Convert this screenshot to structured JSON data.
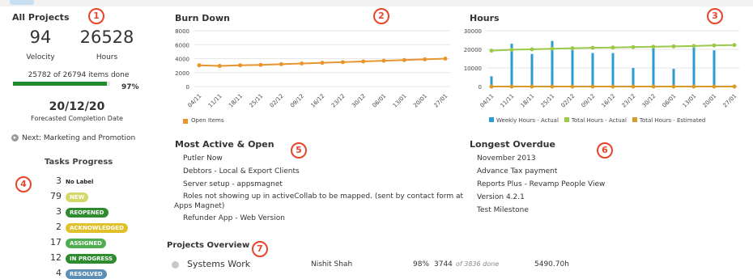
{
  "all_projects": {
    "title": "All Projects",
    "velocity_value": "94",
    "velocity_label": "Velocity",
    "hours_value": "26528",
    "hours_label": "Hours",
    "items_done": "25782 of 26794 items done",
    "progress_pct": "97%",
    "progress_fraction": 0.97,
    "forecast_date": "20/12/20",
    "forecast_label": "Forecasted Completion Date",
    "next_text": "Next: Marketing and Promotion"
  },
  "tasks_progress": {
    "title": "Tasks Progress",
    "rows": [
      {
        "count": "3",
        "label": "No Label",
        "color": ""
      },
      {
        "count": "79",
        "label": "NEW",
        "color": "#d4d86a"
      },
      {
        "count": "3",
        "label": "REOPENED",
        "color": "#2e8b2e"
      },
      {
        "count": "2",
        "label": "ACKNOWLEDGED",
        "color": "#e0c12a"
      },
      {
        "count": "17",
        "label": "ASSIGNED",
        "color": "#4fae4f"
      },
      {
        "count": "12",
        "label": "IN PROGRESS",
        "color": "#2e8b2e"
      },
      {
        "count": "4",
        "label": "RESOLVED",
        "color": "#5b8fb6"
      }
    ]
  },
  "callouts": [
    "1",
    "2",
    "3",
    "4",
    "5",
    "6",
    "7"
  ],
  "burn_down": {
    "title": "Burn Down",
    "legend": "Open Items",
    "legend_color": "#e8952c"
  },
  "hours": {
    "title": "Hours",
    "legend": [
      "Weekly Hours - Actual",
      "Total Hours - Actual",
      "Total Hours - Estimated"
    ],
    "legend_colors": [
      "#2b9bd3",
      "#9cc94a",
      "#d99a2a"
    ]
  },
  "chart_data": [
    {
      "type": "line",
      "title": "Burn Down",
      "categories": [
        "04/11",
        "11/11",
        "18/11",
        "25/11",
        "02/12",
        "09/12",
        "16/12",
        "23/12",
        "30/12",
        "06/01",
        "13/01",
        "20/01",
        "27/01"
      ],
      "series": [
        {
          "name": "Open Items",
          "values": [
            3050,
            2950,
            3050,
            3100,
            3200,
            3300,
            3400,
            3500,
            3600,
            3700,
            3800,
            3900,
            4000
          ]
        }
      ],
      "y_ticks": [
        "0",
        "2000",
        "4000",
        "6000",
        "8000"
      ],
      "ylim": [
        0,
        8000
      ],
      "grid": true,
      "legend_position": "bottom"
    },
    {
      "type": "bar",
      "title": "Hours",
      "categories": [
        "04/11",
        "11/11",
        "18/11",
        "25/11",
        "02/12",
        "09/12",
        "16/12",
        "23/12",
        "30/12",
        "06/01",
        "13/01",
        "20/01",
        "27/01"
      ],
      "series": [
        {
          "name": "Weekly Hours - Actual",
          "values": [
            5500,
            23000,
            17500,
            24500,
            19500,
            18000,
            18000,
            10000,
            20500,
            9500,
            22000,
            19500,
            0
          ]
        },
        {
          "name": "Total Hours - Actual",
          "values": [
            19300,
            19800,
            20000,
            20300,
            20600,
            20800,
            21000,
            21200,
            21400,
            21600,
            21800,
            22100,
            22300
          ]
        },
        {
          "name": "Total Hours - Estimated",
          "values": [
            0,
            0,
            0,
            0,
            0,
            0,
            0,
            0,
            0,
            0,
            0,
            0,
            0
          ]
        }
      ],
      "y_ticks": [
        "0",
        "10000",
        "20000",
        "30000"
      ],
      "ylim": [
        0,
        30000
      ],
      "grid": true,
      "legend_position": "bottom"
    }
  ],
  "most_active": {
    "title": "Most Active & Open",
    "items": [
      "Putler Now",
      "Debtors - Local & Export Clients",
      "Server setup - appsmagnet",
      "Roles not showing up in activeCollab to be mapped. (sent by contact form at",
      "Apps Magnet)",
      "Refunder App - Web Version"
    ]
  },
  "longest_overdue": {
    "title": "Longest Overdue",
    "items": [
      "November 2013",
      "Advance Tax payment",
      "Reports Plus - Revamp People View",
      "Version 4.2.1",
      "Test Milestone"
    ]
  },
  "projects_overview": {
    "title": "Projects Overview",
    "project_name": "Systems Work",
    "owner": "Nishit Shah",
    "percent": "98%",
    "done_count": "3744",
    "done_suffix": "of 3836 done",
    "hours": "5490.70h"
  }
}
